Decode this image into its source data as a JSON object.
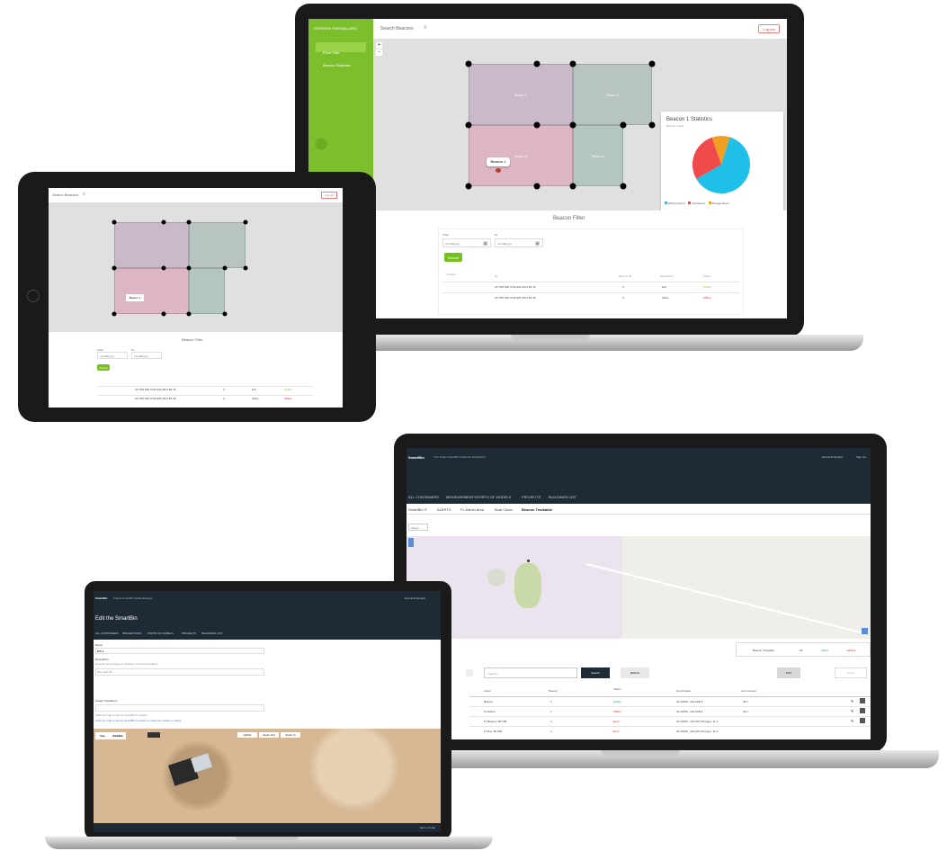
{
  "laptop_top": {
    "sidebar_title": "PARTNER FIREWALLERS",
    "sidebar_items": [
      "Floor Plan",
      "Beacon Statistics"
    ],
    "header_title": "Search Beacons",
    "logout_label": "Log out",
    "zoom_in": "+",
    "zoom_out": "−",
    "room_labels": [
      "Room 1",
      "Room 2",
      "Room 3",
      "Room 4"
    ],
    "tooltip": "Beacon 1",
    "stats_title": "Beacon 1 Statistics",
    "stats_subtitle": "Beacon 1 data",
    "legend": [
      "Waiting Room",
      "Operations",
      "Storage Room"
    ],
    "legend_colors": [
      "#1ec0e8",
      "#f04a4a",
      "#f0a020"
    ],
    "pie_values": [
      62,
      28,
      10
    ],
    "filter_title": "Beacon Filter",
    "from_label": "From",
    "to_label": "To",
    "date_placeholder": "mm/dd/yyyy",
    "search_button": "Search",
    "table_headers": [
      "Location",
      "ID",
      "Beacon ID",
      "Description",
      "Status"
    ],
    "rows": [
      {
        "id": "A5 78D 54D 0743 E4H 8C2 B4 15",
        "beacon": "0",
        "desc": "Exit",
        "status": "Online",
        "status_color": "#78c01c"
      },
      {
        "id": "A5 78D 54D 0743 E4H 8C2 B4 28",
        "beacon": "0",
        "desc": "Stairs",
        "status": "Offline",
        "status_color": "#e02020"
      }
    ]
  },
  "tablet": {
    "header_title": "Search Beacons",
    "logout_label": "Log out",
    "tooltip": "Beacon 1",
    "filter_title": "Beacon Filter",
    "from_label": "From",
    "to_label": "To",
    "date_placeholder": "mm/dd/yyyy",
    "search_button": "Search",
    "rows": [
      {
        "id": "A5 78D 54D 0743 E4H 8C2 B4 15",
        "beacon": "0",
        "desc": "Exit",
        "status": "Online",
        "status_color": "#78c01c"
      },
      {
        "id": "A5 78D 54D 0743 E4H 8C2 B4 28",
        "beacon": "0",
        "desc": "Stairs",
        "status": "Offline",
        "status_color": "#e02020"
      }
    ]
  },
  "laptop_right": {
    "app_name": "SmartBin",
    "breadcrumb": "Your Smart SmartBin Collection Dashboard",
    "user_label": "Eventual Support",
    "logout_label": "Sign out",
    "nav_tabs": [
      "ALL CONTAINERS",
      "MEASUREMENTS",
      "PORTS OF MODELS",
      "PROJECTS",
      "BUILDINGS LIST"
    ],
    "sub_tabs": [
      "SmartBin IT",
      "ALERTS",
      "FL Admin Area",
      "Boat Clean",
      "Beacon Trackable"
    ],
    "map_dropdown": "Select...",
    "assign_dropdown": "Beacon Trackable",
    "active_filter": "Active",
    "inactive_filter": "Inactive",
    "all_filter": "All",
    "search_placeholder": "Search...",
    "search_button": "Search",
    "refresh_button": "Refresh",
    "print_button": "Print",
    "export_button": "Export",
    "table_headers": [
      "Label",
      "Beacon",
      "Status",
      "Coordinates",
      "Last Contact"
    ],
    "rows": [
      {
        "label": "Beacon",
        "beacon": "1",
        "status": "Online",
        "status_color": "#1fa84f",
        "coords": "32.44456, -104.20513",
        "last": "45.1"
      },
      {
        "label": "Container",
        "beacon": "1",
        "status": "Offline",
        "status_color": "#e02020",
        "coords": "32.44456, -104.20514",
        "last": "45.1"
      },
      {
        "label": "FL Beacon 1B 14B",
        "beacon": "2",
        "status": "Error",
        "status_color": "#e02020",
        "coords": "32.44456, -104.205 (Orange), 11.4",
        "last": "45.1"
      },
      {
        "label": "FL Box 1B 15B",
        "beacon": "1",
        "status": "Error",
        "status_color": "#e02020",
        "coords": "32.44456, -104.205 (Orange), 11.4",
        "last": "45.1"
      }
    ]
  },
  "laptop_bottom": {
    "app_name": "SmartBin",
    "breadcrumb": "Project SmartBin Detail Manager",
    "user_label": "Eventual Support",
    "page_title": "Edit the SmartBin",
    "nav_tabs": [
      "ALL CONTAINERS",
      "PROJECTIONS",
      "PORTS OF MODELS",
      "PROJECTS",
      "BUILDINGS LIST"
    ],
    "name_label": "Name",
    "name_value": "BIN 1",
    "description_label": "Description",
    "description_hint": "Describe the purpose or location of the bin container",
    "description_value": "Site Yard 1B",
    "assignment_label": "Assign Containers",
    "assignment_hint": "Click the map to set the SmartBin's location",
    "link_text": "Click the map to set the SmartBin's location or drag the marker to adjust",
    "map_tab_map": "Map",
    "map_tab_satellite": "Satellite",
    "map_buttons": [
      "Hybrid",
      "Zoom Out",
      "Zoom In"
    ],
    "footer_text": "Terms of Use"
  }
}
